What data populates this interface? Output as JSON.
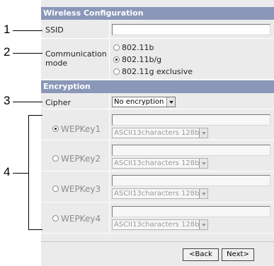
{
  "callouts": [
    "1",
    "2",
    "3",
    "4"
  ],
  "wireless": {
    "header": "Wireless Configuration",
    "ssid_label": "SSID",
    "ssid_value": "",
    "mode_label_line1": "Communication",
    "mode_label_line2": "mode",
    "modes": [
      "802.11b",
      "802.11b/g",
      "802.11g exclusive"
    ],
    "selected_mode": "802.11b/g"
  },
  "encryption": {
    "header": "Encryption",
    "cipher_label": "Cipher",
    "cipher_value": "No encryption",
    "keys": [
      {
        "label": "WEPKey1",
        "selected": true,
        "value": "",
        "format": "ASCII13characters 128bit"
      },
      {
        "label": "WEPKey2",
        "selected": false,
        "value": "",
        "format": "ASCII13characters 128bit"
      },
      {
        "label": "WEPKey3",
        "selected": false,
        "value": "",
        "format": "ASCII13characters 128bit"
      },
      {
        "label": "WEPKey4",
        "selected": false,
        "value": "",
        "format": "ASCII13characters 128bit"
      }
    ]
  },
  "buttons": {
    "back": "<Back",
    "next": "Next>"
  }
}
